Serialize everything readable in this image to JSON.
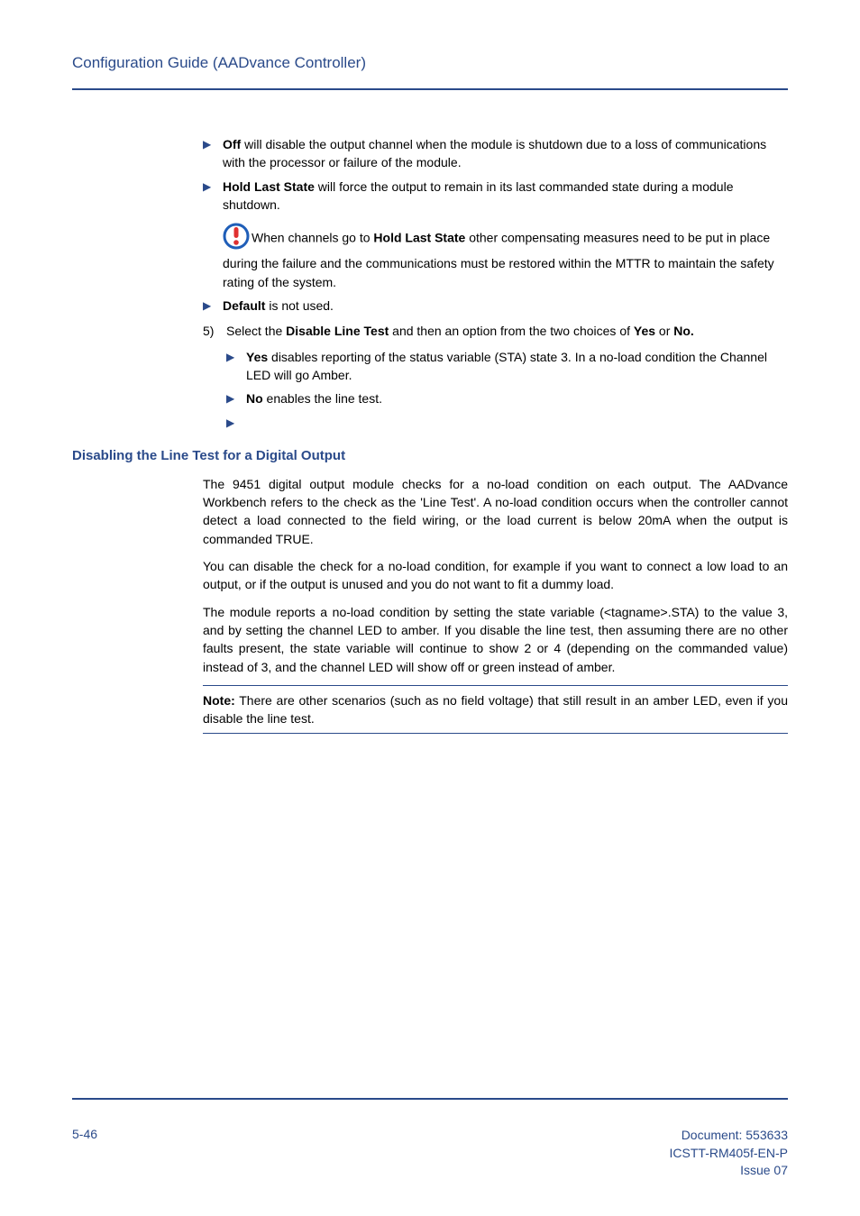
{
  "header": {
    "title": "Configuration Guide (AADvance Controller)"
  },
  "bullets_lvl1": {
    "b0": {
      "label": "Off",
      "rest": " will disable the output channel when the module is shutdown due to a loss of communications with the processor or failure of the module."
    },
    "b1": {
      "label": "Hold Last State",
      "rest": " will force the output to remain in its last commanded state during a module shutdown."
    },
    "warn": {
      "pre": "When channels go to ",
      "bold": "Hold Last State",
      "rest": " other compensating measures need to be put in place during the failure and the communications must be restored within the MTTR to maintain the safety rating of the system."
    },
    "b2": {
      "label": "Default",
      "rest": " is not used."
    }
  },
  "step5": {
    "num": "5)",
    "pre": "Select the ",
    "bold1": "Disable Line Test",
    "mid": " and then an option from the two choices of ",
    "bold2": "Yes",
    "mid2": " or ",
    "bold3": "No."
  },
  "step5_sub": {
    "s0": {
      "label": "Yes",
      "rest": " disables reporting of the status variable (STA) state 3. In a no-load condition the Channel LED will go Amber."
    },
    "s1": {
      "label": "No",
      "rest": " enables the line test."
    }
  },
  "section": {
    "heading": "Disabling the Line Test for a Digital Output",
    "p1": "The 9451 digital output module checks for a no-load condition on each output. The AADvance Workbench refers to the check as the 'Line Test'. A no-load condition occurs when the controller cannot detect a load connected to the field wiring, or the load current is below 20mA when the output is commanded TRUE.",
    "p2": "You can disable the check for a no-load condition, for example if you want to connect a low load to an output, or if the output is unused and you do not want to fit a dummy load.",
    "p3": "The module reports a no-load condition by setting the state variable (<tagname>.STA) to the value 3, and by setting the channel LED to amber. If you disable the line test, then assuming there are no other faults present, the state variable will continue to show 2 or 4 (depending on the commanded value) instead of 3, and the channel LED will show off or green instead of amber.",
    "note_label": "Note:",
    "note_text": " There are other scenarios (such as no field voltage) that still result in an amber LED, even if you disable the line test."
  },
  "footer": {
    "page": "5-46",
    "doc": "Document: 553633",
    "code": "ICSTT-RM405f-EN-P",
    "issue": "Issue 07"
  }
}
